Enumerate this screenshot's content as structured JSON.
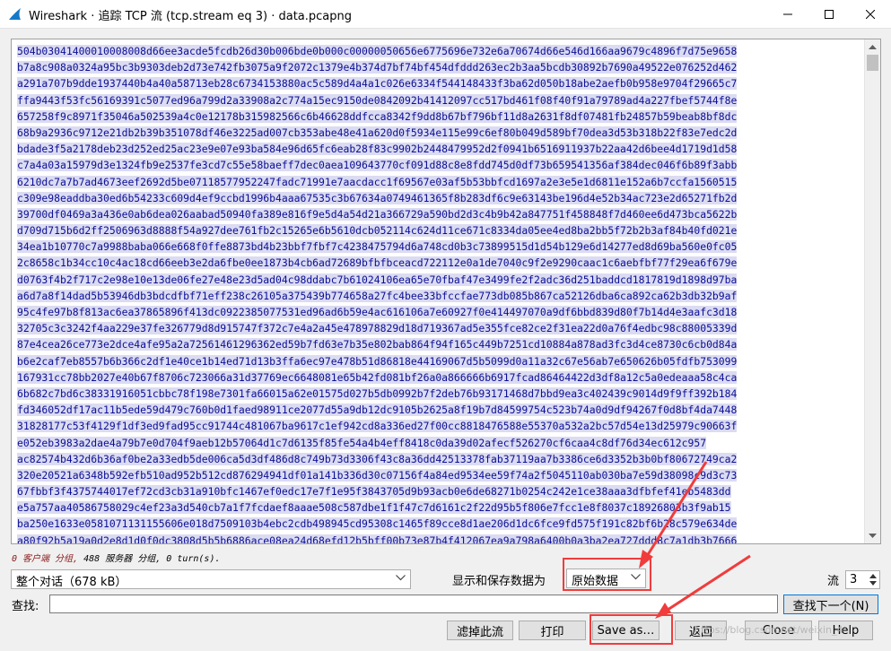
{
  "window": {
    "title": "Wireshark · 追踪 TCP 流 (tcp.stream eq 3) · data.pcapng",
    "minimize_icon": "minimize-icon",
    "maximize_icon": "maximize-icon",
    "close_icon": "close-icon"
  },
  "stream": {
    "lines": [
      "504b03041400010008008d66ee3acde5fcdb26d30b006bde0b000c00000050656e6775696e732e6a70674d66e546d166aa9679c4896f7d75e9658",
      "b7a8c908a0324a95bc3b9303deb2d73e742fb3075a9f2072c1379e4b374d7bf74bf454dfddd263ec2b3aa5bcdb30892b7690a49522e076252d462",
      "a291a707b9dde1937440b4a40a58713eb28c6734153880ac5c589d4a4a1c026e6334f544148433f3ba62d050b18abe2aefb0b958e9704f29665c7",
      "ffa9443f53fc56169391c5077ed96a799d2a33908a2c774a15ec9150de0842092b41412097cc517bd461f08f40f91a79789ad4a227fbef5744f8e",
      "657258f9c8971f35046a502539a4c0e12178b315982566c6b46628ddfcca8342f9dd8b67bf796bf11d8a2631f8df07481fb24857b59beab8bf8dc",
      "68b9a2936c9712e21db2b39b351078df46e3225ad007cb353abe48e41a620d0f5934e115e99c6ef80b049d589bf70dea3d53b318b22f83e7edc2d",
      "bdade3f5a2178deb23d252ed25ac23e9e07e93ba584e96d65fc6eab28f83c9902b2448479952d2f0941b6516911937b22aa42d6bee4d1719d1d58",
      "c7a4a03a15979d3e1324fb9e2537fe3cd7c55e58baeff7dec0aea109643770cf091d88c8e8fdd745d0df73b659541356af384dec046f6b89f3abb",
      "6210dc7a7b7ad4673eef2692d5be07118577952247fadc71991e7aacdacc1f69567e03af5b53bbfcd1697a2e3e5e1d6811e152a6b7ccfa1560515",
      "c309e98eaddba30ed6b54233c609d4ef9ccbd1996b4aaa67535c3b67634a0749461365f8b283df6c9e63143be196d4e52b34ac723e2d65271fb2d",
      "39700df0469a3a436e0ab6dea026aabad50940fa389e816f9e5d4a54d21a366729a590bd2d3c4b9b42a847751f458848f7d460ee6d473bca5622b",
      "d709d715b6d2ff2506963d8888f54a927dee761fb2c15265e6b5610dcb052114c624d11ce671c8334da05ee4ed8ba2bb5f72b2b3af84b40fd021e",
      "34ea1b10770c7a9988baba066e668f0ffe8873bd4b23bbf7fbf7c4238475794d6a748cd0b3c73899515d1d54b129e6d14277ed8d69ba560e0fc05",
      "2c8658c1b34cc10c4ac18cd66eeb3e2da6fbe0ee1873b4cb6ad72689bfbfbceacd722112e0a1de7040c9f2e9290caac1c6aebfbf77f29ea6f679e",
      "d0763f4b2f717c2e98e10e13de06fe27e48e23d5ad04c98ddabc7b61024106ea65e70fbaf47e3499fe2f2adc36d251baddcd1817819d1898d97ba",
      "a6d7a8f14dad5b53946db3bdcdfbf71eff238c26105a375439b774658a27fc4bee33bfccfae773db085b867ca52126dba6ca892ca62b3db32b9af",
      "95c4fe97b8f813ac6ea37865896f413dc0922385077531ed96ad6b59e4ac616106a7e60927f0e414497070a9df6bbd839d80f7b14d4e3aafc3d18",
      "32705c3c3242f4aa229e37fe326779d8d915747f372c7e4a2a45e478978829d18d719367ad5e355fce82ce2f31ea22d0a76f4edbc98c88005339d",
      "87e4cea26ce773e2dce4afe95a2a72561461296362ed59b7fd63e7b35e802bab864f94f165c449b7251cd10884a878ad3fc3d4ce8730c6cb0d84a",
      "b6e2caf7eb8557b6b366c2df1e40ce1b14ed71d13b3ffa6ec97e478b51d86818e44169067d5b5099d0a11a32c67e56ab7e650626b05fdfb753099",
      "167931cc78bb2027e40b67f8706c723066a31d37769ec6648081e65b42fd081bf26a0a866666b6917fcad86464422d3df8a12c5a0edeaaa58c4ca",
      "6b682c7bd6c38331916051cbbc78f198e7301fa66015a62e01575d027b5db0992b7f2deb76b93171468d7bbd9ea3c402439c9014d9f9ff392b184",
      "fd346052df17ac11b5ede59d479c760b0d1faed98911ce2077d55a9db12dc9105b2625a8f19b7d84599754c523b74a0d9df94267f0d8bf4da7448",
      "31828177c53f4129f1df3ed9fad95cc91744c481067ba9617c1ef942cd8a336ed27f00cc8818476588e55370a532a2bc57d54e13d25979c90663f",
      "e052eb3983a2dae4a79b7e0d704f9aeb12b57064d1c7d6135f85fe54a4b4eff8418c0da39d02afecf526270cf6caa4c8df76d34ec612c957",
      "ac82574b432d6b36af0be2a33edb5de006ca5d3df486d8c749b73d3306f43c8a36dd42513378fab37119aa7b3386ce6d3352b3b0bf80672749ca2",
      "320e20521a6348b592efb510ad952b512cd876294941df01a141b336d30c07156f4a84ed9534ee59f74a2f5045110ab030ba7e59d38098c9d3c73",
      "67fbbf3f4375744017ef72cd3cb31a910bfc1467ef0edc17e7f1e95f3843705d9b93acb0e6de68271b0254c242e1ce38aaa3dfbfef41eb5483dd",
      "e5a757aa40586758029c4ef23a3d540cb7a1f7fcdaef8aaae508c587dbe1f1f47c7d6161c2f22d95b5f806e7fcc1e8f8037c18926803b3f9ab15",
      "ba250e1633e0581071131155606e018d7509103b4ebc2cdb498945cd95308c1465f89cce8d1ae206d1dc6fce9fd575f191c82bf6b28c579e634de",
      "a80f92b5a19a0d2e8d1d0f0dc3808d5b5b6886ace08ea24d68efd12b5bff00b73e87b4f412067ea9a798a6400b0a3ba2ea727ddd8c7a1db3b7666"
    ]
  },
  "summary": {
    "client_label": "0 客户端 分组,",
    "server_label": "488 服务器 分组,",
    "turns_label": "0 turn(s)."
  },
  "conversation_select": {
    "value": "整个对话（678 kB）"
  },
  "display_format": {
    "label": "显示和保存数据为",
    "value": "原始数据"
  },
  "stream_number": {
    "label": "流",
    "value": "3"
  },
  "find": {
    "label": "查找:",
    "value": "",
    "find_next_label": "查找下一个(N)"
  },
  "buttons": {
    "filter_out": "滤掉此流",
    "print": "打印",
    "save_as": "Save as…",
    "back": "返回",
    "close": "Close",
    "help": "Help"
  },
  "watermark": "https://blog.csdn.net/weixin_4",
  "colors": {
    "stream_text": "#0b0f93",
    "stream_highlight": "#dbdbf2",
    "annotation_red": "#f03c3c",
    "client_text": "#8b1a1a"
  }
}
